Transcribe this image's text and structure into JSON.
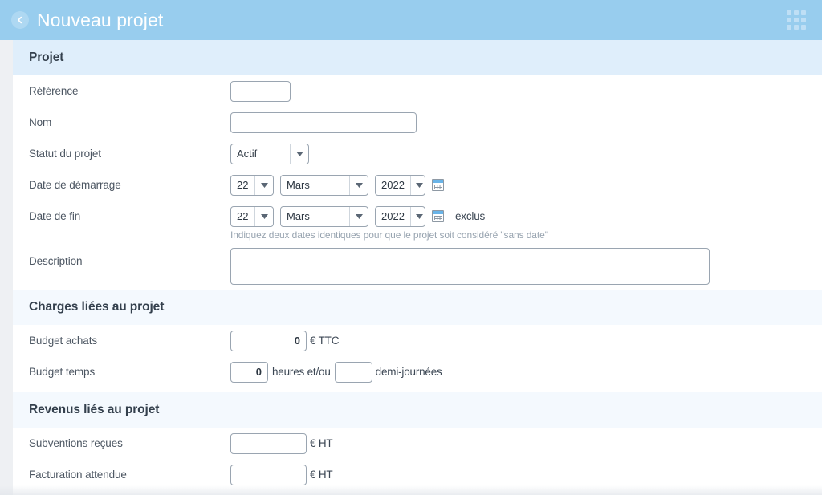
{
  "appbar": {
    "back_icon": "back-arrow-icon",
    "title": "Nouveau projet",
    "apps_icon": "grid-apps-icon"
  },
  "colors": {
    "appbar_bg": "#98cdee",
    "section_primary_bg": "#dfeefb",
    "section_secondary_bg": "#f4f9fe",
    "page_bg": "#eef0f3",
    "label_text": "#4c5662",
    "heading_text": "#34404d",
    "input_border": "#9aa5b1",
    "hint_text": "#98a4b0",
    "calendar_icon_accent": "#69b4e8"
  },
  "sections": [
    {
      "title": "Projet",
      "style": "primary",
      "fields": {
        "reference": {
          "label": "Référence",
          "value": "",
          "placeholder": ""
        },
        "nom": {
          "label": "Nom",
          "value": "",
          "placeholder": ""
        },
        "statut": {
          "label": "Statut du projet",
          "value": "Actif"
        },
        "date_demarrage": {
          "label": "Date de démarrage",
          "day": "22",
          "month": "Mars",
          "year": "2022",
          "calendar_icon": "calendar-icon"
        },
        "date_fin": {
          "label": "Date de fin",
          "day": "22",
          "month": "Mars",
          "year": "2022",
          "calendar_icon": "calendar-icon",
          "suffix": "exclus"
        },
        "hint": "Indiquez deux dates identiques pour que le projet soit considéré \"sans date\"",
        "description": {
          "label": "Description",
          "value": "",
          "placeholder": ""
        }
      }
    },
    {
      "title": "Charges liées au projet",
      "style": "secondary",
      "fields": {
        "budget_achats": {
          "label": "Budget achats",
          "value": "0",
          "unit": "€ TTC"
        },
        "budget_temps": {
          "label": "Budget temps",
          "hours_value": "0",
          "hours_unit": "heures et/ou",
          "halfdays_value": "",
          "halfdays_unit": "demi-journées"
        }
      }
    },
    {
      "title": "Revenus liés au projet",
      "style": "secondary",
      "fields": {
        "subventions": {
          "label": "Subventions reçues",
          "value": "",
          "unit": "€ HT"
        },
        "facturation": {
          "label": "Facturation attendue",
          "value": "",
          "unit": "€ HT"
        }
      }
    }
  ]
}
